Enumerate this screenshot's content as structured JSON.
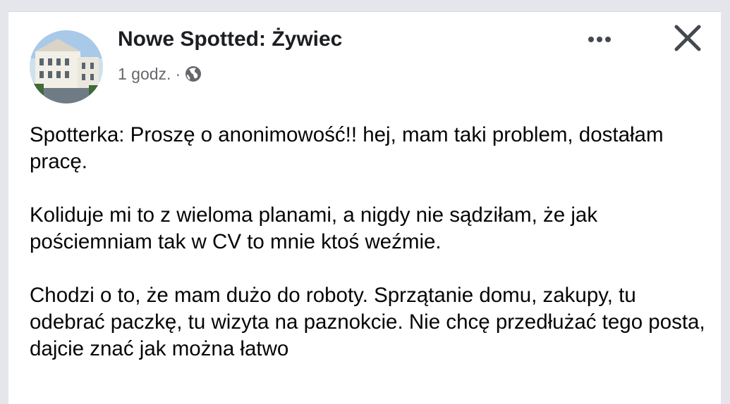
{
  "post": {
    "page_name": "Nowe Spotted: Żywiec",
    "time": "1 godz.",
    "separator": "·",
    "audience_icon": "globe-icon",
    "more_icon": "more-options-icon",
    "close_icon": "close-icon",
    "paragraphs": [
      "Spotterka: Proszę o anonimowość!! hej, mam taki problem, dostałam pracę.",
      "Koliduje mi to z wieloma planami, a nigdy nie sądziłam, że jak pościemniam tak w CV to mnie ktoś weźmie.",
      "Chodzi o to, że mam dużo do roboty. Sprzątanie domu, zakupy, tu odebrać paczkę, tu wizyta na paznokcie. Nie chcę przedłużać tego posta, dajcie znać jak można łatwo"
    ]
  },
  "colors": {
    "background": "#e4e6eb",
    "card": "#ffffff",
    "primary_text": "#050505",
    "secondary_text": "#65676b"
  }
}
